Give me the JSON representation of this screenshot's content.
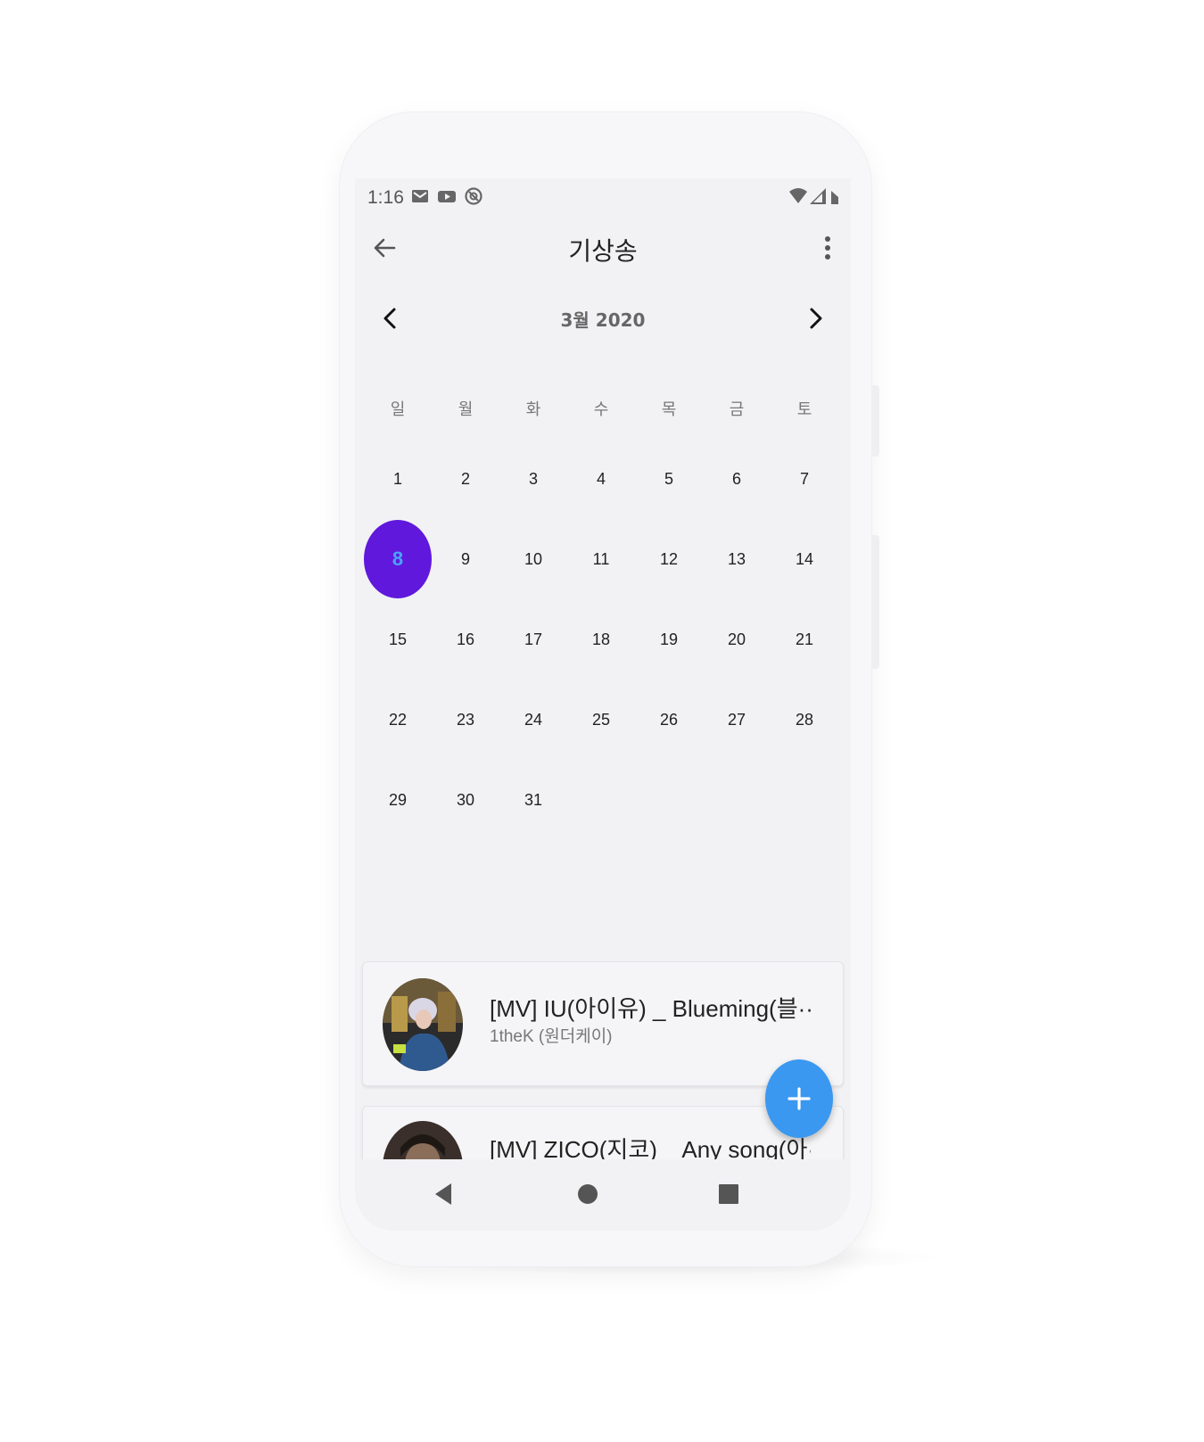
{
  "status_bar": {
    "time": "1:16",
    "left_icons": [
      "gmail-icon",
      "youtube-icon",
      "at-sign-icon"
    ],
    "right_icons": [
      "wifi-icon",
      "signal-icon",
      "battery-icon"
    ]
  },
  "app_bar": {
    "title": "기상송"
  },
  "calendar": {
    "month_label": "3월 2020",
    "weekdays": [
      "일",
      "월",
      "화",
      "수",
      "목",
      "금",
      "토"
    ],
    "weeks": [
      [
        "1",
        "2",
        "3",
        "4",
        "5",
        "6",
        "7"
      ],
      [
        "8",
        "9",
        "10",
        "11",
        "12",
        "13",
        "14"
      ],
      [
        "15",
        "16",
        "17",
        "18",
        "19",
        "20",
        "21"
      ],
      [
        "22",
        "23",
        "24",
        "25",
        "26",
        "27",
        "28"
      ],
      [
        "29",
        "30",
        "31",
        "",
        "",
        "",
        ""
      ]
    ],
    "selected_day": "8",
    "selected_color": "#6018dc"
  },
  "list": {
    "items": [
      {
        "title": "[MV] IU(아이유) _ Blueming(블··",
        "subtitle": "1theK (원더케이)"
      },
      {
        "title": "[MV] ZICO(지코) _ Any song(아··",
        "subtitle": ""
      }
    ]
  },
  "fab": {
    "icon": "plus-icon",
    "color": "#3a98f0"
  },
  "nav_bar": {
    "icons": [
      "back-triangle-icon",
      "home-circle-icon",
      "recents-square-icon"
    ]
  }
}
